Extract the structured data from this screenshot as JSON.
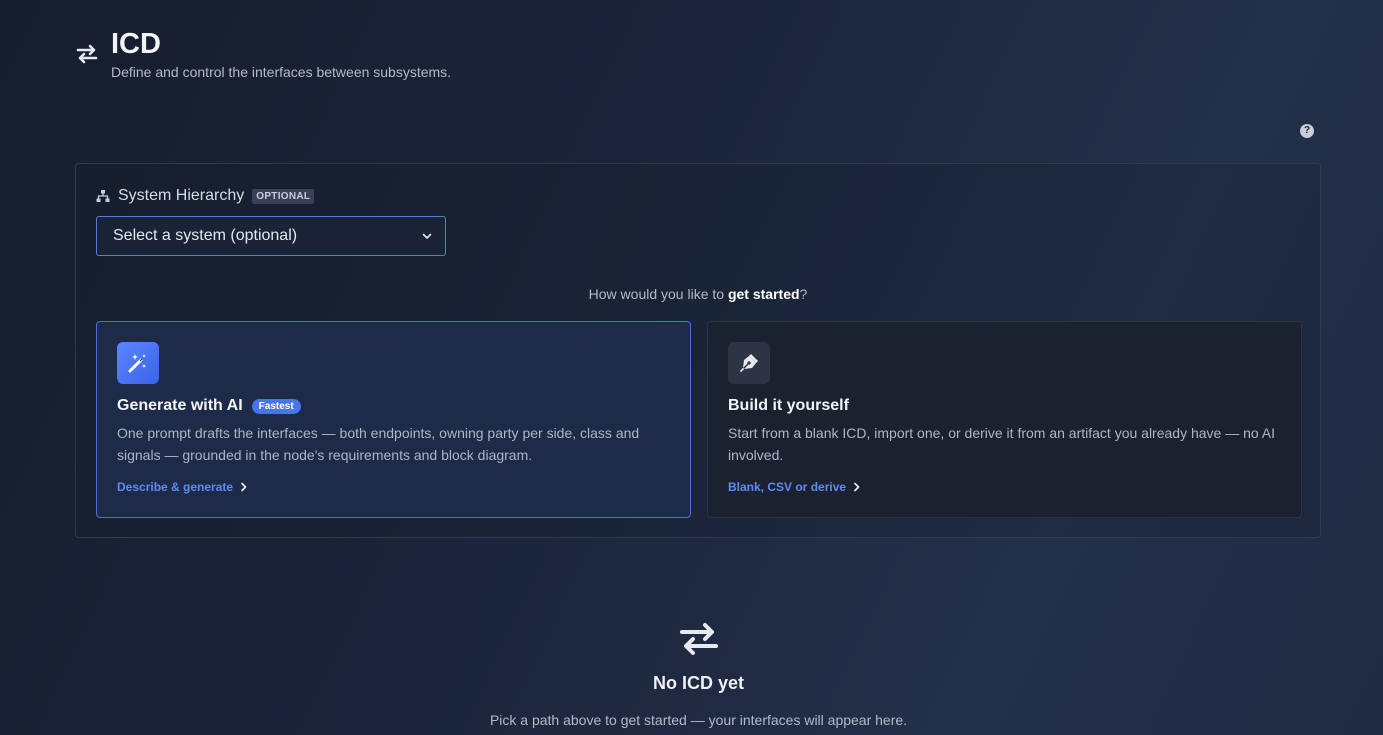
{
  "header": {
    "icon": "arrows-exchange-icon",
    "title": "ICD",
    "subtitle": "Define and control the interfaces between subsystems."
  },
  "help": {
    "icon": "help-circle-icon",
    "glyph": "?"
  },
  "hierarchy": {
    "icon": "hierarchy-icon",
    "label": "System Hierarchy",
    "badge": "OPTIONAL",
    "select_value": "Select a system (optional)"
  },
  "prompt": {
    "before": "How would you like to ",
    "bold": "get started",
    "after": "?"
  },
  "cards": {
    "ai": {
      "icon": "magic-wand-icon",
      "title": "Generate with AI",
      "badge": "Fastest",
      "description": "One prompt drafts the interfaces — both endpoints, owning party per side, class and signals — grounded in the node's requirements and block diagram.",
      "link": "Describe & generate"
    },
    "manual": {
      "icon": "pen-nib-icon",
      "title": "Build it yourself",
      "description": "Start from a blank ICD, import one, or derive it from an artifact you already have — no AI involved.",
      "link": "Blank, CSV or derive"
    }
  },
  "empty_state": {
    "icon": "arrows-exchange-icon",
    "title": "No ICD yet",
    "text": "Pick a path above to get started — your interfaces will appear here."
  },
  "colors": {
    "accent": "#4a74ef",
    "link": "#5f8bf5",
    "background": "#1b2438"
  }
}
